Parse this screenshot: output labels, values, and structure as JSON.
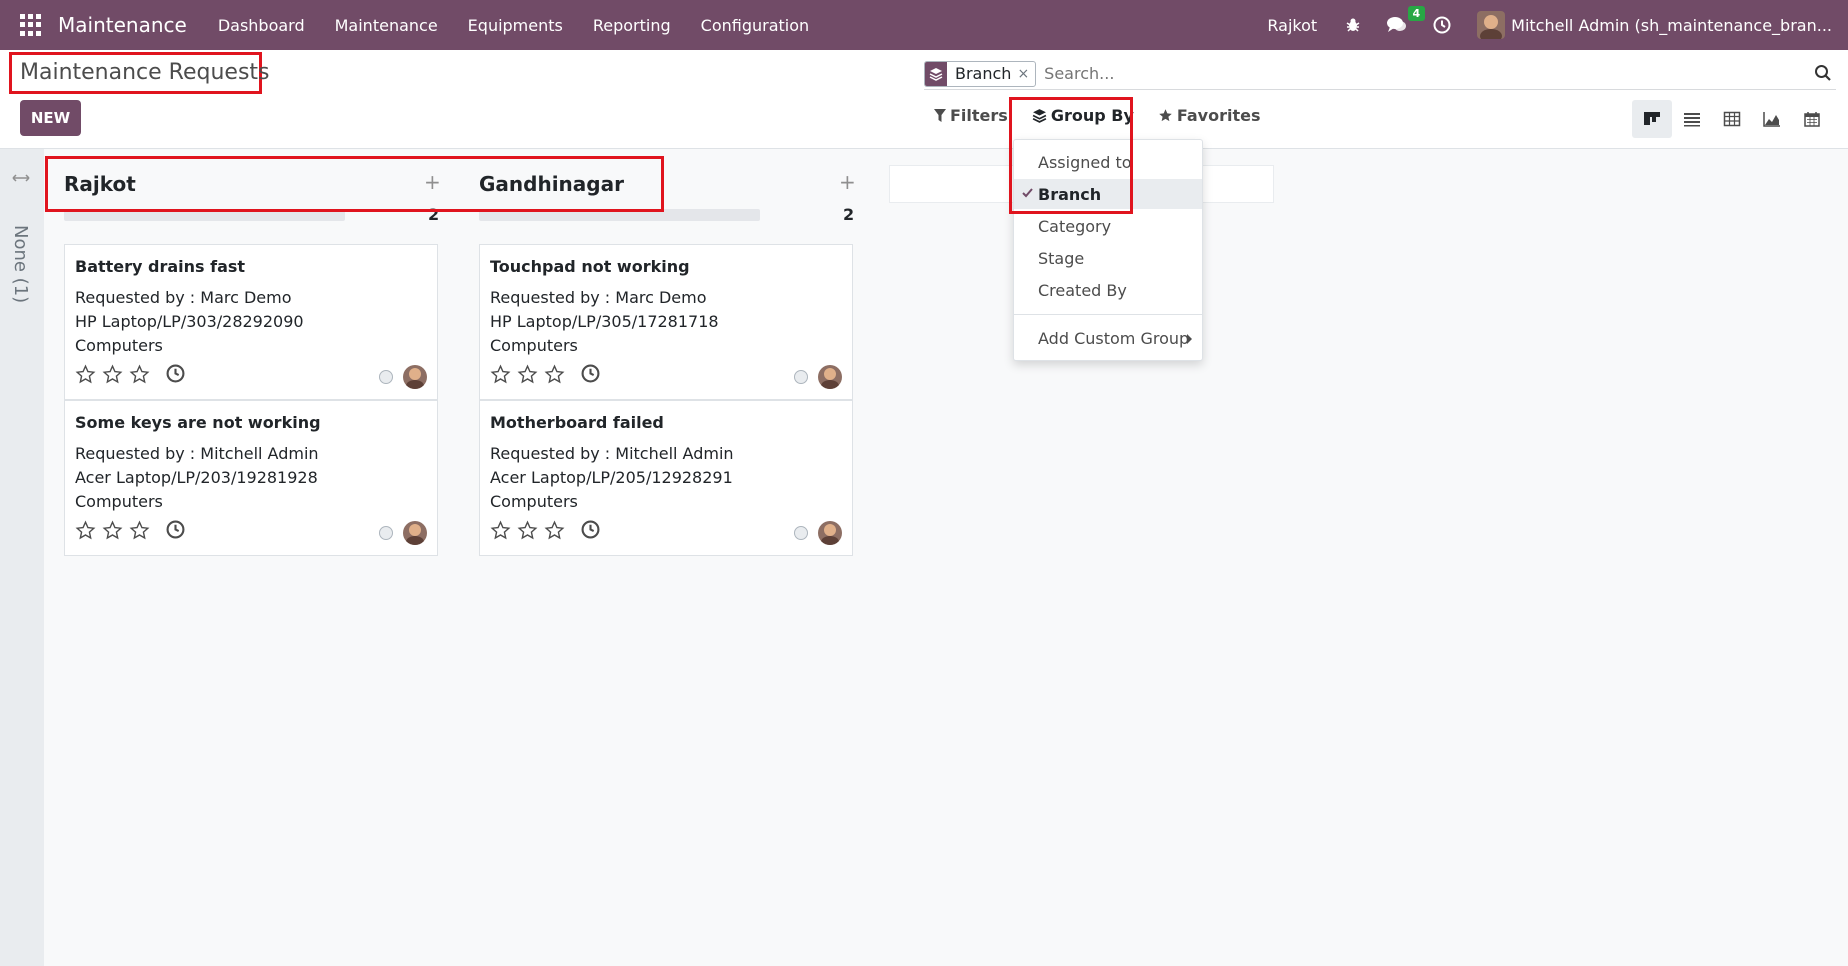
{
  "navbar": {
    "app_name": "Maintenance",
    "menu": [
      "Dashboard",
      "Maintenance",
      "Equipments",
      "Reporting",
      "Configuration"
    ],
    "company": "Rajkot",
    "messages_count": "4",
    "user": "Mitchell Admin (sh_maintenance_bran..."
  },
  "control_panel": {
    "title": "Maintenance Requests",
    "new_label": "NEW",
    "search": {
      "facet_label": "Branch",
      "facet_remove": "×",
      "placeholder": "Search..."
    },
    "filters_label": "Filters",
    "groupby_label": "Group By",
    "favorites_label": "Favorites"
  },
  "groupby_menu": {
    "items": [
      "Assigned to",
      "Branch",
      "Category",
      "Stage",
      "Created By"
    ],
    "selected": "Branch",
    "custom_label": "Add Custom Group"
  },
  "kanban": {
    "folded": {
      "label": "None (1)"
    },
    "columns": [
      {
        "name": "Rajkot",
        "count": "2",
        "cards": [
          {
            "title": "Battery drains fast",
            "requested_by": "Requested by : Marc Demo",
            "equipment": "HP Laptop/LP/303/28292090",
            "category": "Computers"
          },
          {
            "title": "Some keys are not working",
            "requested_by": "Requested by : Mitchell Admin",
            "equipment": "Acer Laptop/LP/203/19281928",
            "category": "Computers"
          }
        ]
      },
      {
        "name": "Gandhinagar",
        "count": "2",
        "cards": [
          {
            "title": "Touchpad not working",
            "requested_by": "Requested by : Marc Demo",
            "equipment": "HP Laptop/LP/305/17281718",
            "category": "Computers"
          },
          {
            "title": "Motherboard failed",
            "requested_by": "Requested by : Mitchell Admin",
            "equipment": "Acer Laptop/LP/205/12928291",
            "category": "Computers"
          }
        ]
      }
    ]
  },
  "colors": {
    "brand": "#714b67",
    "highlight": "#e0141e",
    "badge": "#28a745"
  }
}
